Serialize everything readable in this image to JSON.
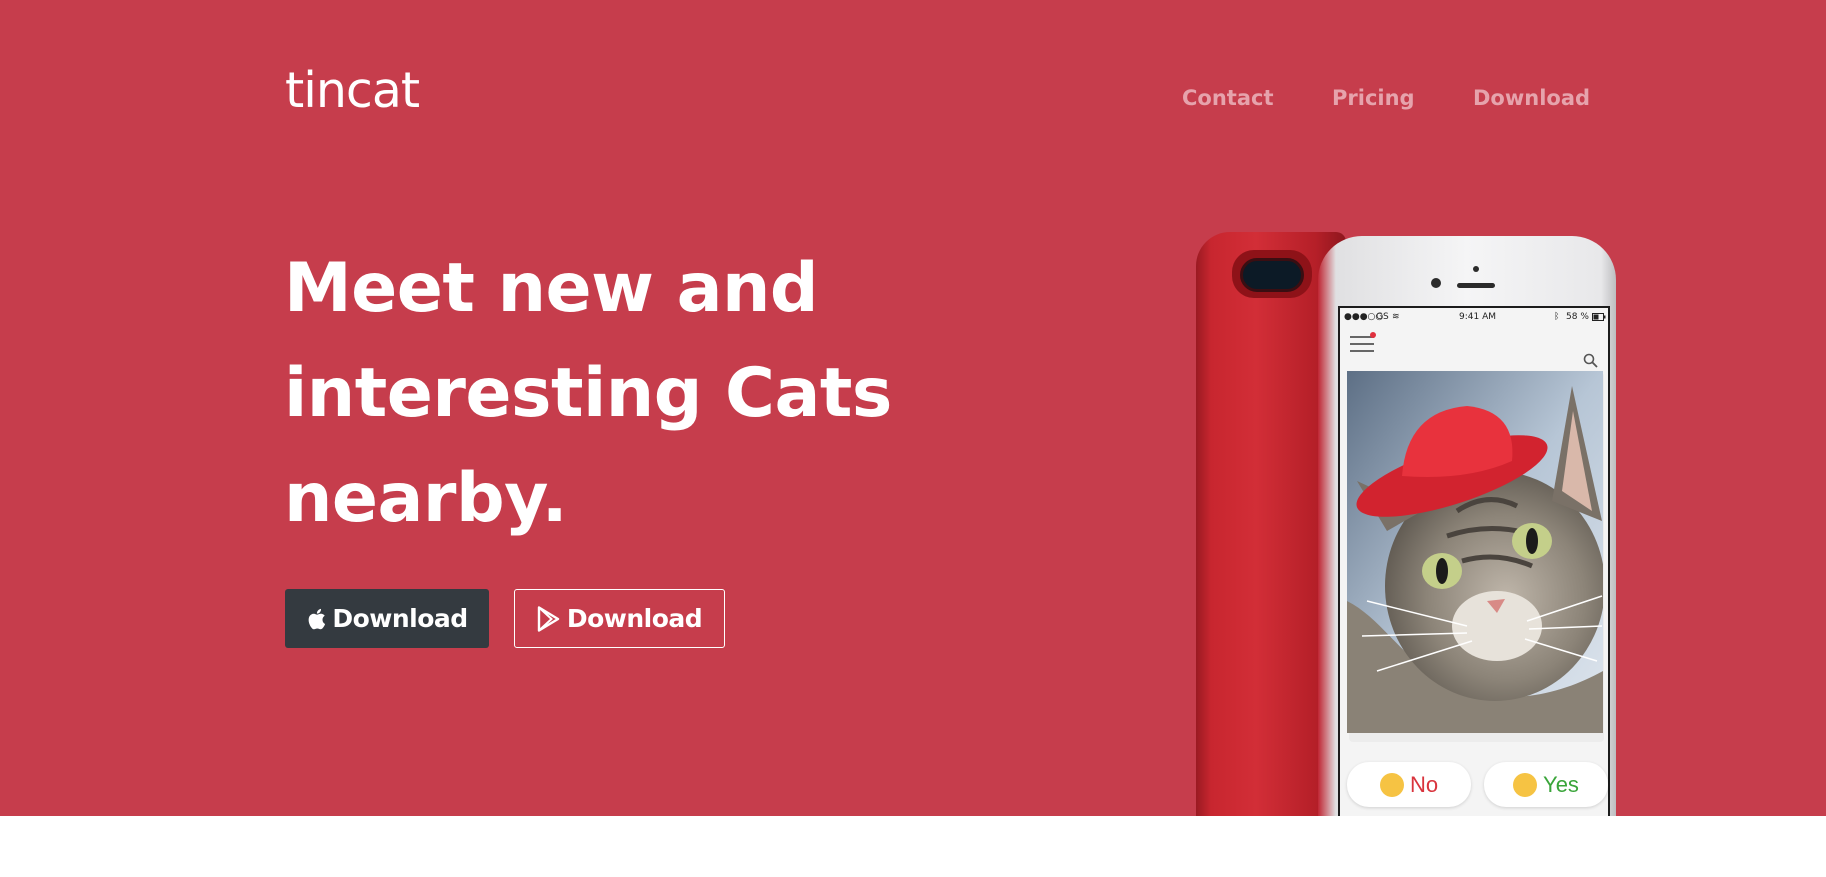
{
  "brand": {
    "logo_text": "tincat"
  },
  "nav": {
    "contact": "Contact",
    "pricing": "Pricing",
    "download": "Download"
  },
  "hero": {
    "headline_line1": "Meet new and",
    "headline_line2": "interesting Cats",
    "headline_line3": "nearby.",
    "apple_button_label": "Download",
    "play_button_label": "Download"
  },
  "phone": {
    "status_carrier": "GS",
    "status_time": "9:41 AM",
    "status_battery": "58 %",
    "no_label": "No",
    "yes_label": "Yes"
  },
  "colors": {
    "hero_background": "#c63d4c",
    "nav_link": "#e6a3ac",
    "apple_button": "#343a40",
    "no_color": "#d9343d",
    "yes_color": "#3aa53a"
  },
  "icons": [
    "apple-icon",
    "google-play-icon",
    "menu-icon",
    "search-icon",
    "wifi-icon",
    "battery-icon",
    "bluetooth-icon"
  ]
}
